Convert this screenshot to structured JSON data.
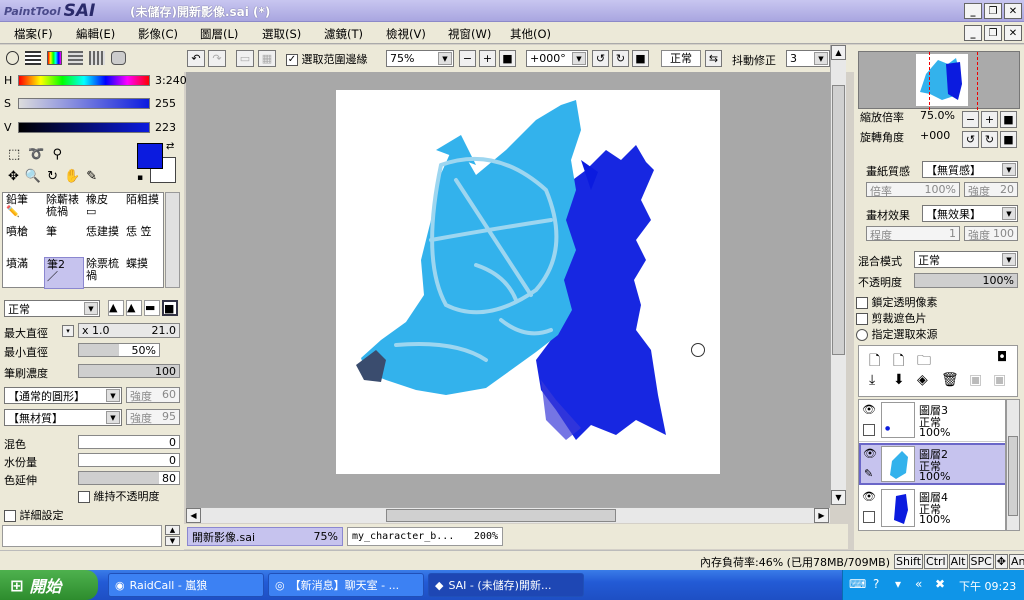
{
  "window": {
    "app_logo_small": "PaintTool",
    "app_logo_big": "SAI",
    "title": "(未儲存)開新影像.sai (*)"
  },
  "menu": [
    "檔案(F)",
    "編輯(E)",
    "影像(C)",
    "圖層(L)",
    "選取(S)",
    "濾鏡(T)",
    "檢視(V)",
    "視窗(W)",
    "其他(O)"
  ],
  "color": {
    "h_label": "H",
    "h_value": "3:240",
    "s_label": "S",
    "s_value": "255",
    "v_label": "V",
    "v_value": "223",
    "primary": "#0b1bdf",
    "secondary": "#ffffff"
  },
  "tools": [
    {
      "label": "鉛筆",
      "selected": false
    },
    {
      "label": "喷枪",
      "selected": false
    },
    {
      "label": "橡皮",
      "selected": false
    },
    {
      "label": "陌粗摸",
      "selected": false
    },
    {
      "label": "噴槍",
      "selected": false
    },
    {
      "label": "筆",
      "selected": false
    },
    {
      "label": "恁建摸",
      "selected": false
    },
    {
      "label": "恁",
      "selected": false
    },
    {
      "label": "笠",
      "selected": false
    },
    {
      "label": "墳滿",
      "selected": false
    },
    {
      "label": "筆2",
      "selected": true
    },
    {
      "label": "除票梳禍",
      "selected": false
    },
    {
      "label": "蝶摸",
      "selected": false
    }
  ],
  "tools_extra": {
    "label1": "除蘄裱梳禍"
  },
  "brush": {
    "mode": "正常",
    "max_size_label": "最大直徑",
    "max_size_mult": "x 1.0",
    "max_size_value": "21.0",
    "min_size_label": "最小直徑",
    "min_size_value": "50%",
    "density_label": "筆刷濃度",
    "density_value": "100",
    "shape": "【通常的圓形】",
    "shape_strength_label": "強度",
    "shape_strength": "60",
    "texture": "【無材質】",
    "texture_strength_label": "強度",
    "texture_strength": "95",
    "blend_label": "混色",
    "blend_value": "0",
    "water_label": "水份量",
    "water_value": "0",
    "persist_label": "色延伸",
    "persist_value": "80",
    "keep_opacity_label": "維持不透明度",
    "detail_label": "詳細設定"
  },
  "toolbar": {
    "selection_edge_label": "選取范圍邊緣",
    "zoom": "75%",
    "rotation": "+000°",
    "blend": "正常",
    "stabilizer_label": "抖動修正",
    "stabilizer": "3"
  },
  "canvas_tabs": [
    {
      "name": "開新影像.sai",
      "zoom": "75%"
    },
    {
      "name": "my_character_b...",
      "zoom": "200%"
    }
  ],
  "navigator": {
    "zoom_label": "縮放倍率",
    "zoom_value": "75.0%",
    "rotate_label": "旋轉角度",
    "rotate_value": "+000"
  },
  "paper": {
    "texture_label": "畫紙質感",
    "texture_value": "【無質感】",
    "scale_label": "倍率",
    "scale_value": "100%",
    "strength_label": "強度",
    "strength_value": "20"
  },
  "effect": {
    "label": "畫材效果",
    "value": "【無效果】",
    "width_label": "程度",
    "width_value": "1",
    "strength_label": "強度",
    "strength_value": "100"
  },
  "layer_props": {
    "blend_label": "混合模式",
    "blend_value": "正常",
    "opacity_label": "不透明度",
    "opacity_value": "100%",
    "lock_label": "鎖定透明像素",
    "clip_label": "剪裁遮色片",
    "source_label": "指定選取來源"
  },
  "layers": [
    {
      "name": "圖層3",
      "mode": "正常",
      "opacity": "100%",
      "selected": false
    },
    {
      "name": "圖層2",
      "mode": "正常",
      "opacity": "100%",
      "selected": true
    },
    {
      "name": "圖層4",
      "mode": "正常",
      "opacity": "100%",
      "selected": false
    }
  ],
  "status": {
    "memory": "內存負荷率:46% (已用78MB/709MB)",
    "keys": [
      "Shift",
      "Ctrl",
      "Alt",
      "SPC",
      "Any"
    ]
  },
  "taskbar": {
    "start": "開始",
    "tasks": [
      {
        "label": "RaidCall - 嵐狼",
        "active": false
      },
      {
        "label": "【新消息】聊天室 - ...",
        "active": false
      },
      {
        "label": "SAI - (未儲存)開新...",
        "active": true
      }
    ],
    "clock": "下午 09:23"
  }
}
